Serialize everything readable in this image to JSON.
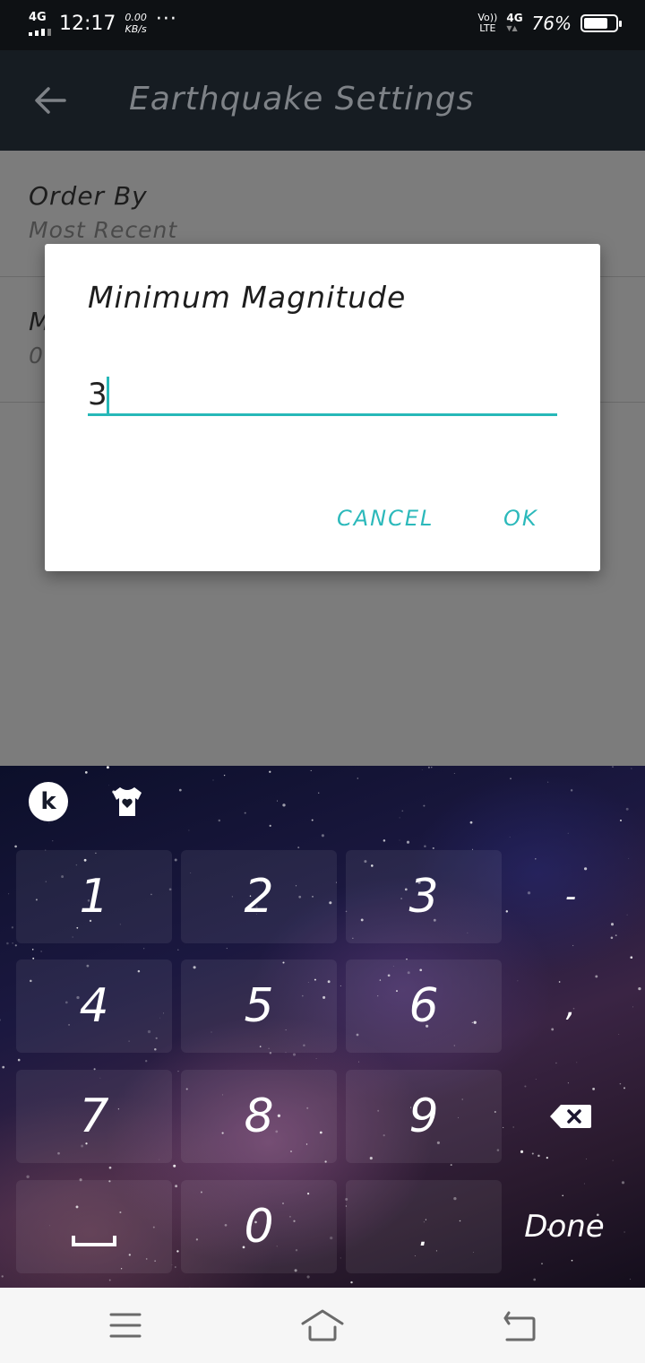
{
  "status_bar": {
    "network_left": "4G",
    "time": "12:17",
    "speed_value": "0.00",
    "speed_unit": "KB/s",
    "overflow": "···",
    "volte_top": "Vo))",
    "volte_bottom": "LTE",
    "network_right": "4G",
    "battery_percent": "76%",
    "battery_level": 0.76
  },
  "app_bar": {
    "title": "Earthquake Settings",
    "back_icon": "arrow-left-icon"
  },
  "settings": {
    "items": [
      {
        "title": "Order By",
        "summary": "Most Recent"
      },
      {
        "title": "M",
        "summary": "0"
      }
    ]
  },
  "dialog": {
    "title": "Minimum Magnitude",
    "input_value": "3",
    "cancel_label": "CANCEL",
    "ok_label": "OK",
    "accent_color": "#2cb9bb"
  },
  "keyboard": {
    "logo_letter": "k",
    "theme_icon": "tshirt-heart-icon",
    "rows": [
      [
        "1",
        "2",
        "3",
        "-"
      ],
      [
        "4",
        "5",
        "6",
        ","
      ],
      [
        "7",
        "8",
        "9",
        "backspace"
      ],
      [
        "space",
        "0",
        ".",
        "Done"
      ]
    ],
    "done_label": "Done"
  },
  "nav_bar": {
    "menu_icon": "menu-icon",
    "home_icon": "home-icon",
    "back_icon": "back-icon"
  }
}
